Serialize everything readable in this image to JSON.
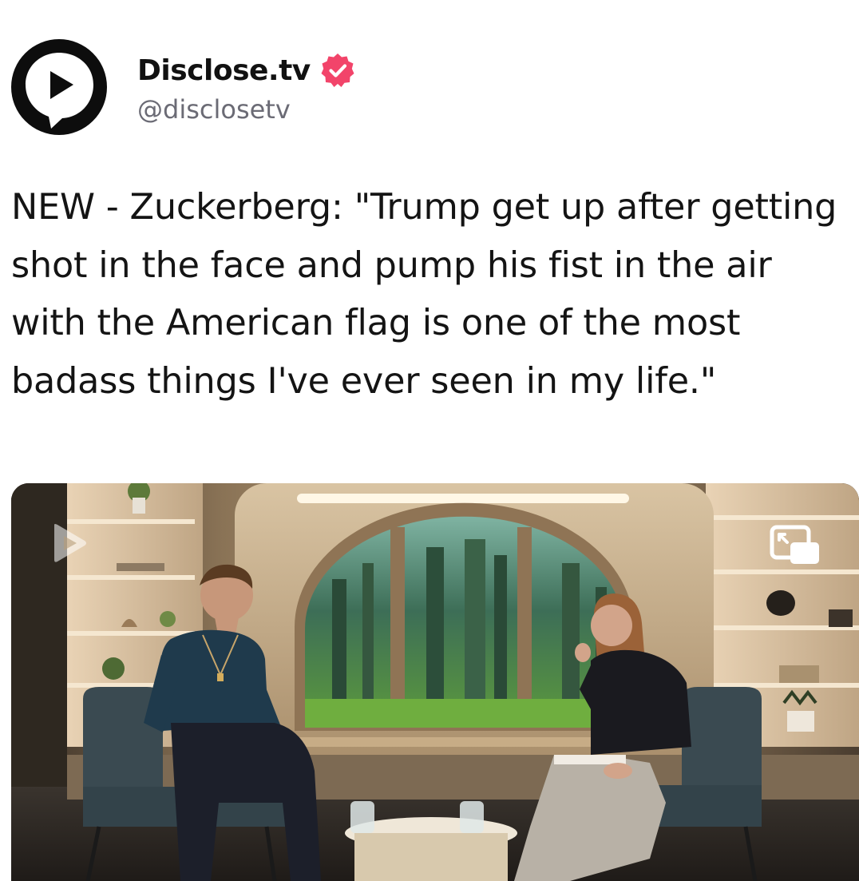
{
  "account": {
    "display_name": "Disclose.tv",
    "handle": "@disclosetv",
    "verified": true,
    "verified_badge_color": "#f2446a",
    "avatar_icon": "play-speech-bubble-icon"
  },
  "post": {
    "text": "NEW - Zuckerberg: \"Trump get up after getting shot in the face and pump his fist in the air with the American flag is one of the most badass things I've ever seen in my life.\""
  },
  "media": {
    "type": "video-still",
    "overlay_icons": [
      "brand-watermark-icon",
      "picture-in-picture-icon"
    ]
  },
  "colors": {
    "text": "#141414",
    "handle": "#6b6b75",
    "background": "#ffffff"
  }
}
